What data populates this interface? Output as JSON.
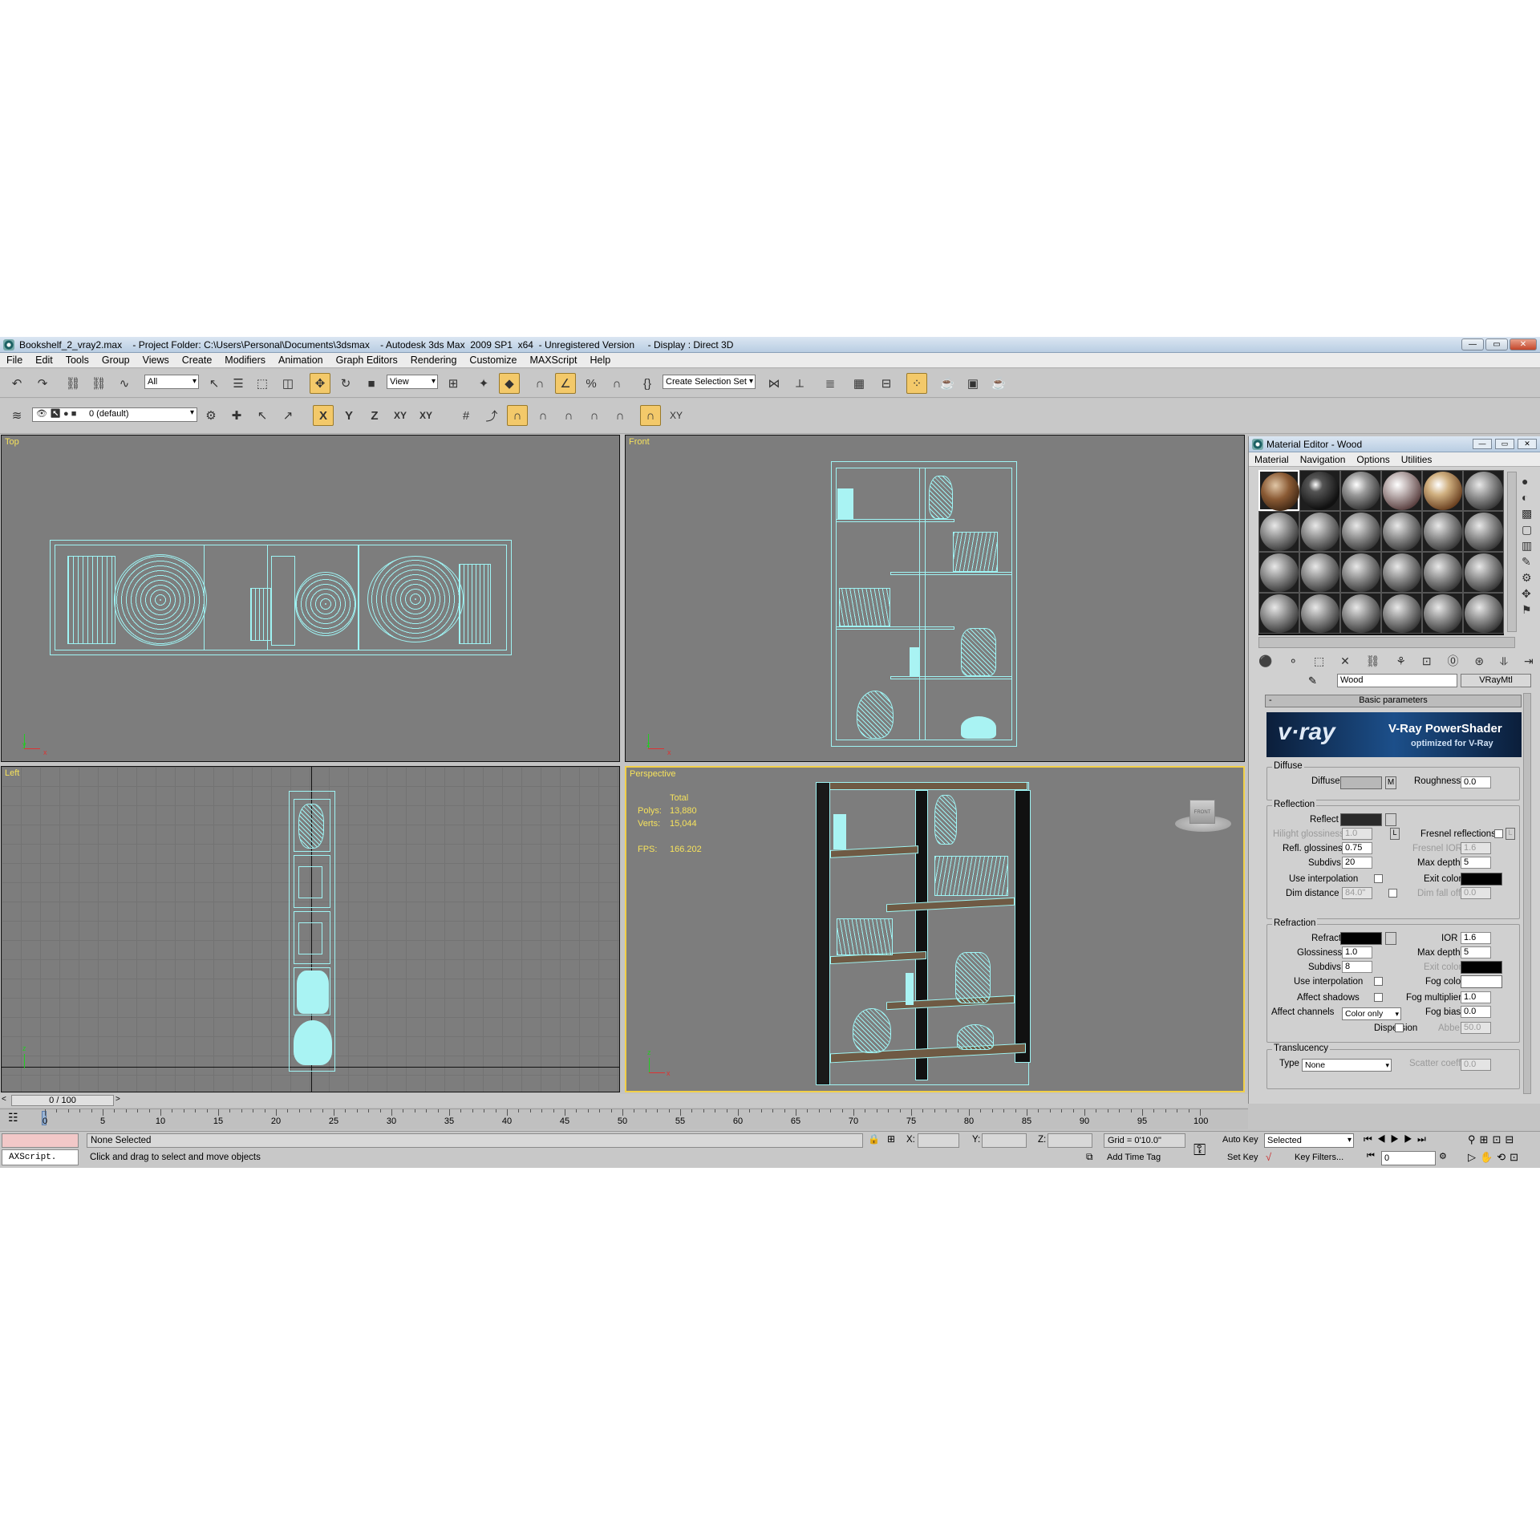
{
  "window": {
    "title": "Bookshelf_2_vray2.max    - Project Folder: C:\\Users\\Personal\\Documents\\3dsmax    - Autodesk 3ds Max  2009 SP1  x64  - Unregistered Version     - Display : Direct 3D",
    "buttons": [
      "—",
      "▭",
      "✕"
    ]
  },
  "menu": [
    "File",
    "Edit",
    "Tools",
    "Group",
    "Views",
    "Create",
    "Modifiers",
    "Animation",
    "Graph Editors",
    "Rendering",
    "Customize",
    "MAXScript",
    "Help"
  ],
  "toolbar": {
    "filter": "All",
    "coord": "View",
    "selection_set": "Create Selection Set"
  },
  "layer": {
    "name": "0 (default)"
  },
  "axes_buttons": [
    "X",
    "Y",
    "Z",
    "XY",
    "XY"
  ],
  "viewports": {
    "top": {
      "label": "Top"
    },
    "front": {
      "label": "Front"
    },
    "left": {
      "label": "Left"
    },
    "perspective": {
      "label": "Perspective",
      "stats": {
        "total": "Total",
        "polys_label": "Polys:",
        "polys": "13,880",
        "verts_label": "Verts:",
        "verts": "15,044",
        "fps_label": "FPS:",
        "fps": "166.202"
      }
    }
  },
  "axis_labels": {
    "x": "x",
    "y": "y",
    "z": "z"
  },
  "viewcube": "FRONT",
  "timeline": {
    "slider": "0 / 100",
    "ticks": [
      "0",
      "5",
      "10",
      "15",
      "20",
      "25",
      "30",
      "35",
      "40",
      "45",
      "50",
      "55",
      "60",
      "65",
      "70",
      "75",
      "80",
      "85",
      "90",
      "95",
      "100"
    ]
  },
  "status": {
    "maxscript": "AXScript.",
    "selection": "None Selected",
    "prompt": "Click and drag to select and move objects",
    "x": "X:",
    "y": "Y:",
    "z": "Z:",
    "grid": "Grid = 0'10.0\"",
    "add_time_tag": "Add Time Tag",
    "auto_key": "Auto Key",
    "set_key": "Set Key",
    "selected": "Selected",
    "key_filters": "Key Filters...",
    "frame": "0"
  },
  "material_editor": {
    "title": "Material Editor - Wood",
    "menu": [
      "Material",
      "Navigation",
      "Options",
      "Utilities"
    ],
    "material_name": "Wood",
    "material_type": "VRayMtl",
    "rollout": "Basic parameters",
    "rollout_toggle": "-",
    "banner": {
      "logo": "v·ray",
      "title": "V-Ray PowerShader",
      "subtitle": "optimized for V-Ray"
    },
    "diffuse": {
      "group": "Diffuse",
      "label": "Diffuse",
      "map": "M",
      "roughness_label": "Roughness",
      "roughness": "0.0"
    },
    "reflection": {
      "group": "Reflection",
      "reflect": "Reflect",
      "hilight_label": "Hilight glossiness",
      "hilight": "1.0",
      "lock": "L",
      "fresnel": "Fresnel reflections",
      "fresnel_lock": "L",
      "refl_gloss_label": "Refl. glossiness",
      "refl_gloss": "0.75",
      "fresnel_ior_label": "Fresnel IOR",
      "fresnel_ior": "1.6",
      "subdivs_label": "Subdivs",
      "subdivs": "20",
      "max_depth_label": "Max depth",
      "max_depth": "5",
      "use_interp": "Use interpolation",
      "exit_color": "Exit color",
      "dim_dist_label": "Dim distance",
      "dim_dist": "84.0\"",
      "dim_falloff_label": "Dim fall off",
      "dim_falloff": "0.0"
    },
    "refraction": {
      "group": "Refraction",
      "refract": "Refract",
      "ior_label": "IOR",
      "ior": "1.6",
      "gloss_label": "Glossiness",
      "gloss": "1.0",
      "max_depth_label": "Max depth",
      "max_depth": "5",
      "subdivs_label": "Subdivs",
      "subdivs": "8",
      "exit_color": "Exit color",
      "use_interp": "Use interpolation",
      "fog_color": "Fog color",
      "affect_shadows": "Affect shadows",
      "fog_mult_label": "Fog multiplier",
      "fog_mult": "1.0",
      "affect_channels": "Affect channels",
      "channels_value": "Color only",
      "fog_bias_label": "Fog bias",
      "fog_bias": "0.0",
      "dispersion": "Dispersion",
      "abbe_label": "Abbe",
      "abbe": "50.0"
    },
    "translucency": {
      "group": "Translucency",
      "type_label": "Type",
      "type": "None",
      "scatter_label": "Scatter coeff",
      "scatter": "0.0"
    }
  },
  "colors": {
    "wire": "#9ff4f4",
    "active": "#f2d048",
    "label": "#f6e25c",
    "wood": "#6f5a44"
  }
}
